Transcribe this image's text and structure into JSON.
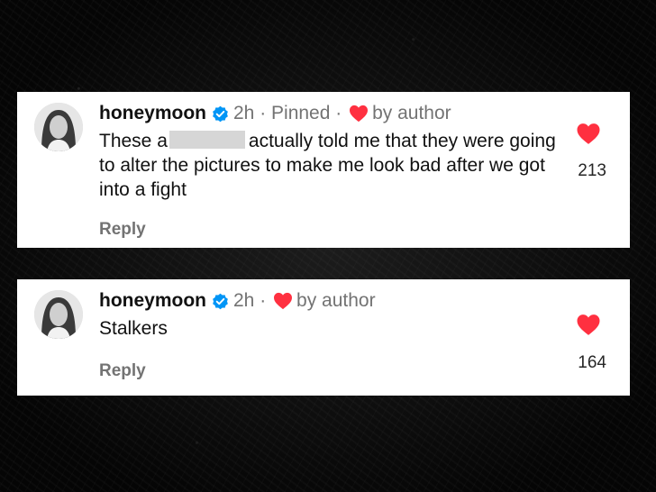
{
  "comments": [
    {
      "username": "honeymoon",
      "time": "2h",
      "pinned_label": "Pinned",
      "liked_by": "by author",
      "text_before": "These a",
      "text_after": "actually told me that they were going to alter the pictures to make me look bad after we got into a fight",
      "reply_label": "Reply",
      "likes": "213"
    },
    {
      "username": "honeymoon",
      "time": "2h",
      "liked_by": "by author",
      "text": "Stalkers",
      "reply_label": "Reply",
      "likes": "164"
    }
  ],
  "icons": {
    "verified": "verified-badge-icon",
    "heart": "heart-icon"
  },
  "colors": {
    "heart_red": "#ff3040",
    "verified_blue": "#0095f6",
    "meta_gray": "#737373"
  }
}
